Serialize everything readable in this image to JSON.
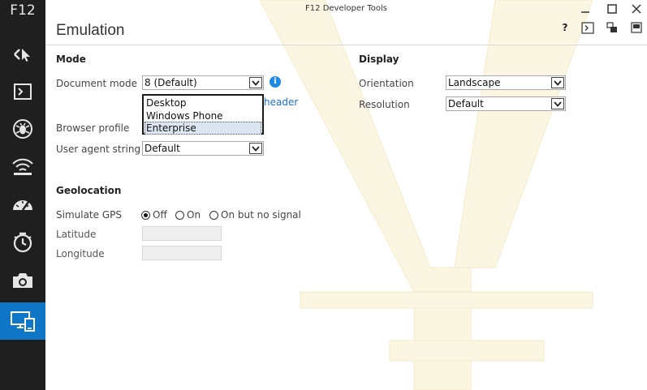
{
  "sidebar": {
    "title": "F12",
    "items": [
      {
        "icon": "dom-explorer-icon"
      },
      {
        "icon": "console-icon"
      },
      {
        "icon": "debugger-icon"
      },
      {
        "icon": "network-icon"
      },
      {
        "icon": "performance-icon"
      },
      {
        "icon": "memory-icon"
      },
      {
        "icon": "camera-icon"
      },
      {
        "icon": "emulation-icon",
        "active": true
      }
    ]
  },
  "window": {
    "title": "F12 Developer Tools"
  },
  "page": {
    "title": "Emulation"
  },
  "toolbar": {
    "help": "?"
  },
  "mode": {
    "heading": "Mode",
    "document_mode_label": "Document mode",
    "document_mode_value": "8 (Default)",
    "browser_profile_label": "Browser profile",
    "browser_profile_options": [
      "Desktop",
      "Windows Phone",
      "Enterprise"
    ],
    "browser_profile_highlighted": "Enterprise",
    "header_link_partial": "header",
    "user_agent_label": "User agent string",
    "user_agent_value": "Default"
  },
  "display": {
    "heading": "Display",
    "orientation_label": "Orientation",
    "orientation_value": "Landscape",
    "resolution_label": "Resolution",
    "resolution_value": "Default"
  },
  "geolocation": {
    "heading": "Geolocation",
    "simulate_gps_label": "Simulate GPS",
    "options": [
      "Off",
      "On",
      "On but no signal"
    ],
    "selected": "Off",
    "latitude_label": "Latitude",
    "longitude_label": "Longitude",
    "latitude_value": "",
    "longitude_value": ""
  },
  "colors": {
    "sidebar_bg": "#1f1f1f",
    "accent": "#0f76c8",
    "link": "#1e6fc8"
  }
}
